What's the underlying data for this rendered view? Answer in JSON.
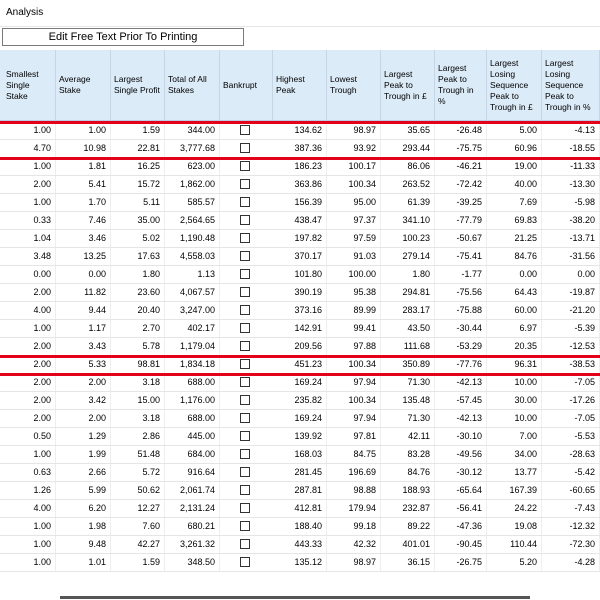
{
  "window": {
    "title": "Analysis"
  },
  "edit_button": {
    "label": "Edit Free Text Prior To Printing"
  },
  "columns": [
    "Smallest Single Stake",
    "Average Stake",
    "Largest Single Profit",
    "Total of All Stakes",
    "Bankrupt",
    "Highest Peak",
    "Lowest Trough",
    "Largest Peak to Trough in £",
    "Largest Peak to Trough in %",
    "Largest Losing Sequence Peak to Trough in £",
    "Largest Losing Sequence Peak to Trough in %"
  ],
  "rows": [
    [
      "1.00",
      "1.00",
      "1.59",
      "344.00",
      "134.62",
      "98.97",
      "35.65",
      "-26.48",
      "5.00",
      "-4.13"
    ],
    [
      "4.70",
      "10.98",
      "22.81",
      "3,777.68",
      "387.36",
      "93.92",
      "293.44",
      "-75.75",
      "60.96",
      "-18.55"
    ],
    [
      "1.00",
      "1.81",
      "16.25",
      "623.00",
      "186.23",
      "100.17",
      "86.06",
      "-46.21",
      "19.00",
      "-11.33"
    ],
    [
      "2.00",
      "5.41",
      "15.72",
      "1,862.00",
      "363.86",
      "100.34",
      "263.52",
      "-72.42",
      "40.00",
      "-13.30"
    ],
    [
      "1.00",
      "1.70",
      "5.11",
      "585.57",
      "156.39",
      "95.00",
      "61.39",
      "-39.25",
      "7.69",
      "-5.98"
    ],
    [
      "0.33",
      "7.46",
      "35.00",
      "2,564.65",
      "438.47",
      "97.37",
      "341.10",
      "-77.79",
      "69.83",
      "-38.20"
    ],
    [
      "1.04",
      "3.46",
      "5.02",
      "1,190.48",
      "197.82",
      "97.59",
      "100.23",
      "-50.67",
      "21.25",
      "-13.71"
    ],
    [
      "3.48",
      "13.25",
      "17.63",
      "4,558.03",
      "370.17",
      "91.03",
      "279.14",
      "-75.41",
      "84.76",
      "-31.56"
    ],
    [
      "0.00",
      "0.00",
      "1.80",
      "1.13",
      "101.80",
      "100.00",
      "1.80",
      "-1.77",
      "0.00",
      "0.00"
    ],
    [
      "2.00",
      "11.82",
      "23.60",
      "4,067.57",
      "390.19",
      "95.38",
      "294.81",
      "-75.56",
      "64.43",
      "-19.87"
    ],
    [
      "4.00",
      "9.44",
      "20.40",
      "3,247.00",
      "373.16",
      "89.99",
      "283.17",
      "-75.88",
      "60.00",
      "-21.20"
    ],
    [
      "1.00",
      "1.17",
      "2.70",
      "402.17",
      "142.91",
      "99.41",
      "43.50",
      "-30.44",
      "6.97",
      "-5.39"
    ],
    [
      "2.00",
      "3.43",
      "5.78",
      "1,179.04",
      "209.56",
      "97.88",
      "111.68",
      "-53.29",
      "20.35",
      "-12.53"
    ],
    [
      "2.00",
      "5.33",
      "98.81",
      "1,834.18",
      "451.23",
      "100.34",
      "350.89",
      "-77.76",
      "96.31",
      "-38.53"
    ],
    [
      "2.00",
      "2.00",
      "3.18",
      "688.00",
      "169.24",
      "97.94",
      "71.30",
      "-42.13",
      "10.00",
      "-7.05"
    ],
    [
      "2.00",
      "3.42",
      "15.00",
      "1,176.00",
      "235.82",
      "100.34",
      "135.48",
      "-57.45",
      "30.00",
      "-17.26"
    ],
    [
      "2.00",
      "2.00",
      "3.18",
      "688.00",
      "169.24",
      "97.94",
      "71.30",
      "-42.13",
      "10.00",
      "-7.05"
    ],
    [
      "0.50",
      "1.29",
      "2.86",
      "445.00",
      "139.92",
      "97.81",
      "42.11",
      "-30.10",
      "7.00",
      "-5.53"
    ],
    [
      "1.00",
      "1.99",
      "51.48",
      "684.00",
      "168.03",
      "84.75",
      "83.28",
      "-49.56",
      "34.00",
      "-28.63"
    ],
    [
      "0.63",
      "2.66",
      "5.72",
      "916.64",
      "281.45",
      "196.69",
      "84.76",
      "-30.12",
      "13.77",
      "-5.42"
    ],
    [
      "1.26",
      "5.99",
      "50.62",
      "2,061.74",
      "287.81",
      "98.88",
      "188.93",
      "-65.64",
      "167.39",
      "-60.65"
    ],
    [
      "4.00",
      "6.20",
      "12.27",
      "2,131.24",
      "412.81",
      "179.94",
      "232.87",
      "-56.41",
      "24.22",
      "-7.43"
    ],
    [
      "1.00",
      "1.98",
      "7.60",
      "680.21",
      "188.40",
      "99.18",
      "89.22",
      "-47.36",
      "19.08",
      "-12.32"
    ],
    [
      "1.00",
      "9.48",
      "42.27",
      "3,261.32",
      "443.33",
      "42.32",
      "401.01",
      "-90.45",
      "110.44",
      "-72.30"
    ],
    [
      "1.00",
      "1.01",
      "1.59",
      "348.50",
      "135.12",
      "98.97",
      "36.15",
      "-26.75",
      "5.20",
      "-4.28"
    ]
  ],
  "highlight_color": "#e2001a",
  "header_color": "#dcebf8"
}
